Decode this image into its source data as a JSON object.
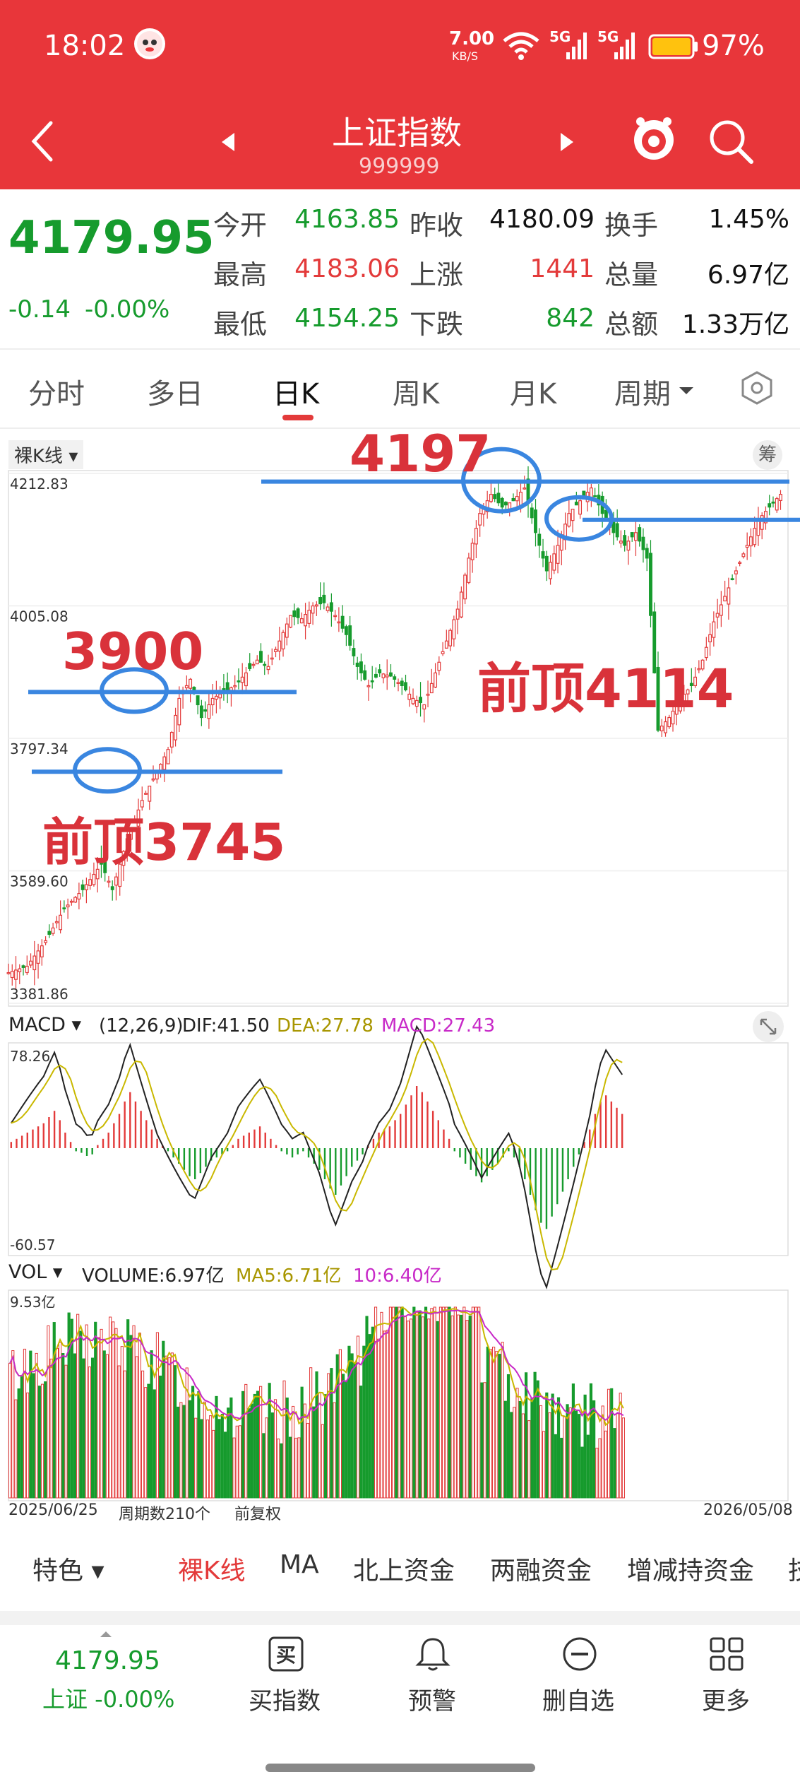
{
  "status_bar": {
    "time": "18:02",
    "net_speed": "7.00",
    "net_unit": "KB/S",
    "sig1": "5G",
    "sig2": "5G",
    "battery": "97%"
  },
  "header": {
    "title": "上证指数",
    "code": "999999"
  },
  "quote": {
    "price": "4179.95",
    "change": "-0.14",
    "change_pct": "-0.00%",
    "rows": [
      [
        {
          "label": "今开",
          "value": "4163.85",
          "color": "#169b2d"
        },
        {
          "label": "昨收",
          "value": "4180.09",
          "color": "#111111"
        },
        {
          "label": "换手",
          "value": "1.45%",
          "color": "#111111"
        }
      ],
      [
        {
          "label": "最高",
          "value": "4183.06",
          "color": "#e33a3a"
        },
        {
          "label": "上涨",
          "value": "1441",
          "color": "#e33a3a"
        },
        {
          "label": "总量",
          "value": "6.97亿",
          "color": "#111111"
        }
      ],
      [
        {
          "label": "最低",
          "value": "4154.25",
          "color": "#169b2d"
        },
        {
          "label": "下跌",
          "value": "842",
          "color": "#169b2d"
        },
        {
          "label": "总额",
          "value": "1.33万亿",
          "color": "#111111"
        }
      ]
    ]
  },
  "tabs": {
    "items": [
      "分时",
      "多日",
      "日K",
      "周K",
      "月K",
      "周期"
    ],
    "active": "日K"
  },
  "kline": {
    "selector": "裸K线",
    "chip_btn": "筹",
    "y_labels": [
      "4212.83",
      "4005.08",
      "3797.34",
      "3589.60",
      "3381.86"
    ],
    "y_range": [
      3381.86,
      4212.83
    ],
    "annotations": [
      {
        "text": "4197",
        "color": "#d9323a"
      },
      {
        "text": "3900",
        "color": "#d9323a"
      },
      {
        "text": "前顶4114",
        "color": "#d9323a"
      },
      {
        "text": "前顶3745",
        "color": "#d9323a"
      }
    ],
    "lines": [
      4200,
      4140,
      3870,
      3745
    ],
    "circles": [
      4200,
      4140,
      3870,
      3745
    ],
    "series_points": [
      [
        0,
        3430
      ],
      [
        5,
        3440
      ],
      [
        10,
        3480
      ],
      [
        15,
        3530
      ],
      [
        20,
        3560
      ],
      [
        25,
        3600
      ],
      [
        28,
        3560
      ],
      [
        32,
        3640
      ],
      [
        36,
        3700
      ],
      [
        40,
        3745
      ],
      [
        43,
        3780
      ],
      [
        46,
        3860
      ],
      [
        49,
        3890
      ],
      [
        52,
        3830
      ],
      [
        55,
        3860
      ],
      [
        58,
        3870
      ],
      [
        61,
        3880
      ],
      [
        64,
        3900
      ],
      [
        67,
        3920
      ],
      [
        70,
        3910
      ],
      [
        73,
        3950
      ],
      [
        76,
        3990
      ],
      [
        79,
        3985
      ],
      [
        82,
        4005
      ],
      [
        85,
        4010
      ],
      [
        88,
        3990
      ],
      [
        91,
        3960
      ],
      [
        94,
        3910
      ],
      [
        97,
        3880
      ],
      [
        100,
        3900
      ],
      [
        103,
        3895
      ],
      [
        106,
        3880
      ],
      [
        109,
        3860
      ],
      [
        112,
        3850
      ],
      [
        115,
        3900
      ],
      [
        118,
        3950
      ],
      [
        121,
        4000
      ],
      [
        124,
        4080
      ],
      [
        127,
        4150
      ],
      [
        130,
        4180
      ],
      [
        133,
        4160
      ],
      [
        136,
        4170
      ],
      [
        139,
        4190
      ],
      [
        142,
        4120
      ],
      [
        145,
        4060
      ],
      [
        148,
        4100
      ],
      [
        151,
        4150
      ],
      [
        154,
        4170
      ],
      [
        157,
        4190
      ],
      [
        160,
        4150
      ],
      [
        163,
        4120
      ],
      [
        166,
        4100
      ],
      [
        169,
        4120
      ],
      [
        172,
        4080
      ],
      [
        175,
        3810
      ],
      [
        178,
        3830
      ],
      [
        181,
        3860
      ],
      [
        184,
        3880
      ],
      [
        187,
        3920
      ],
      [
        190,
        3980
      ],
      [
        193,
        4020
      ],
      [
        196,
        4060
      ],
      [
        199,
        4100
      ],
      [
        202,
        4140
      ],
      [
        205,
        4160
      ],
      [
        208,
        4180
      ]
    ]
  },
  "macd": {
    "label": "MACD",
    "params": "(12,26,9)",
    "dif": "DIF:41.50",
    "dea": "DEA:27.78",
    "macd": "MACD:27.43",
    "y_top": "78.26",
    "y_bottom": "-60.57",
    "dif_color": "#222222",
    "dea_color": "#c9b800",
    "macd_color": "#c82ac8",
    "hist": [
      4,
      6,
      8,
      10,
      12,
      14,
      16,
      20,
      24,
      18,
      10,
      4,
      -2,
      -3,
      -5,
      -4,
      2,
      6,
      10,
      16,
      22,
      30,
      36,
      30,
      24,
      18,
      12,
      6,
      2,
      -2,
      -6,
      -10,
      -14,
      -18,
      -20,
      -16,
      -12,
      -8,
      -6,
      -4,
      -2,
      2,
      6,
      8,
      10,
      12,
      14,
      10,
      6,
      2,
      -2,
      -4,
      -6,
      -4,
      -2,
      -6,
      -10,
      -14,
      -20,
      -26,
      -30,
      -24,
      -18,
      -12,
      -8,
      -4,
      2,
      6,
      10,
      12,
      14,
      18,
      22,
      28,
      34,
      40,
      36,
      30,
      24,
      18,
      12,
      6,
      -2,
      -6,
      -10,
      -14,
      -18,
      -22,
      -18,
      -14,
      -10,
      -6,
      -2,
      -6,
      -12,
      -20,
      -30,
      -40,
      -48,
      -52,
      -44,
      -36,
      -28,
      -20,
      -12,
      -4,
      4,
      12,
      22,
      30,
      34,
      30,
      26,
      22
    ]
  },
  "vol": {
    "label": "VOL",
    "volume": "VOLUME:6.97亿",
    "ma5": "MA5:6.71亿",
    "ma10": "10:6.40亿",
    "y_top": "9.53亿",
    "ma5_color": "#c9b800",
    "ma10_color": "#c82ac8",
    "start_date": "2025/06/25",
    "periods": "周期数210个",
    "adjust": "前复权",
    "end_date": "2026/05/08"
  },
  "bottom_tabs": {
    "items": [
      "特色",
      "裸K线",
      "MA",
      "北上资金",
      "两融资金",
      "增减持资金",
      "技"
    ]
  },
  "bottom_nav": {
    "price": "4179.95",
    "index_label": "上证 -0.00%",
    "items": [
      {
        "label": "买指数",
        "icon": "buy-icon"
      },
      {
        "label": "预警",
        "icon": "bell-icon"
      },
      {
        "label": "删自选",
        "icon": "minus-circle-icon"
      },
      {
        "label": "更多",
        "icon": "grid-icon"
      }
    ]
  }
}
